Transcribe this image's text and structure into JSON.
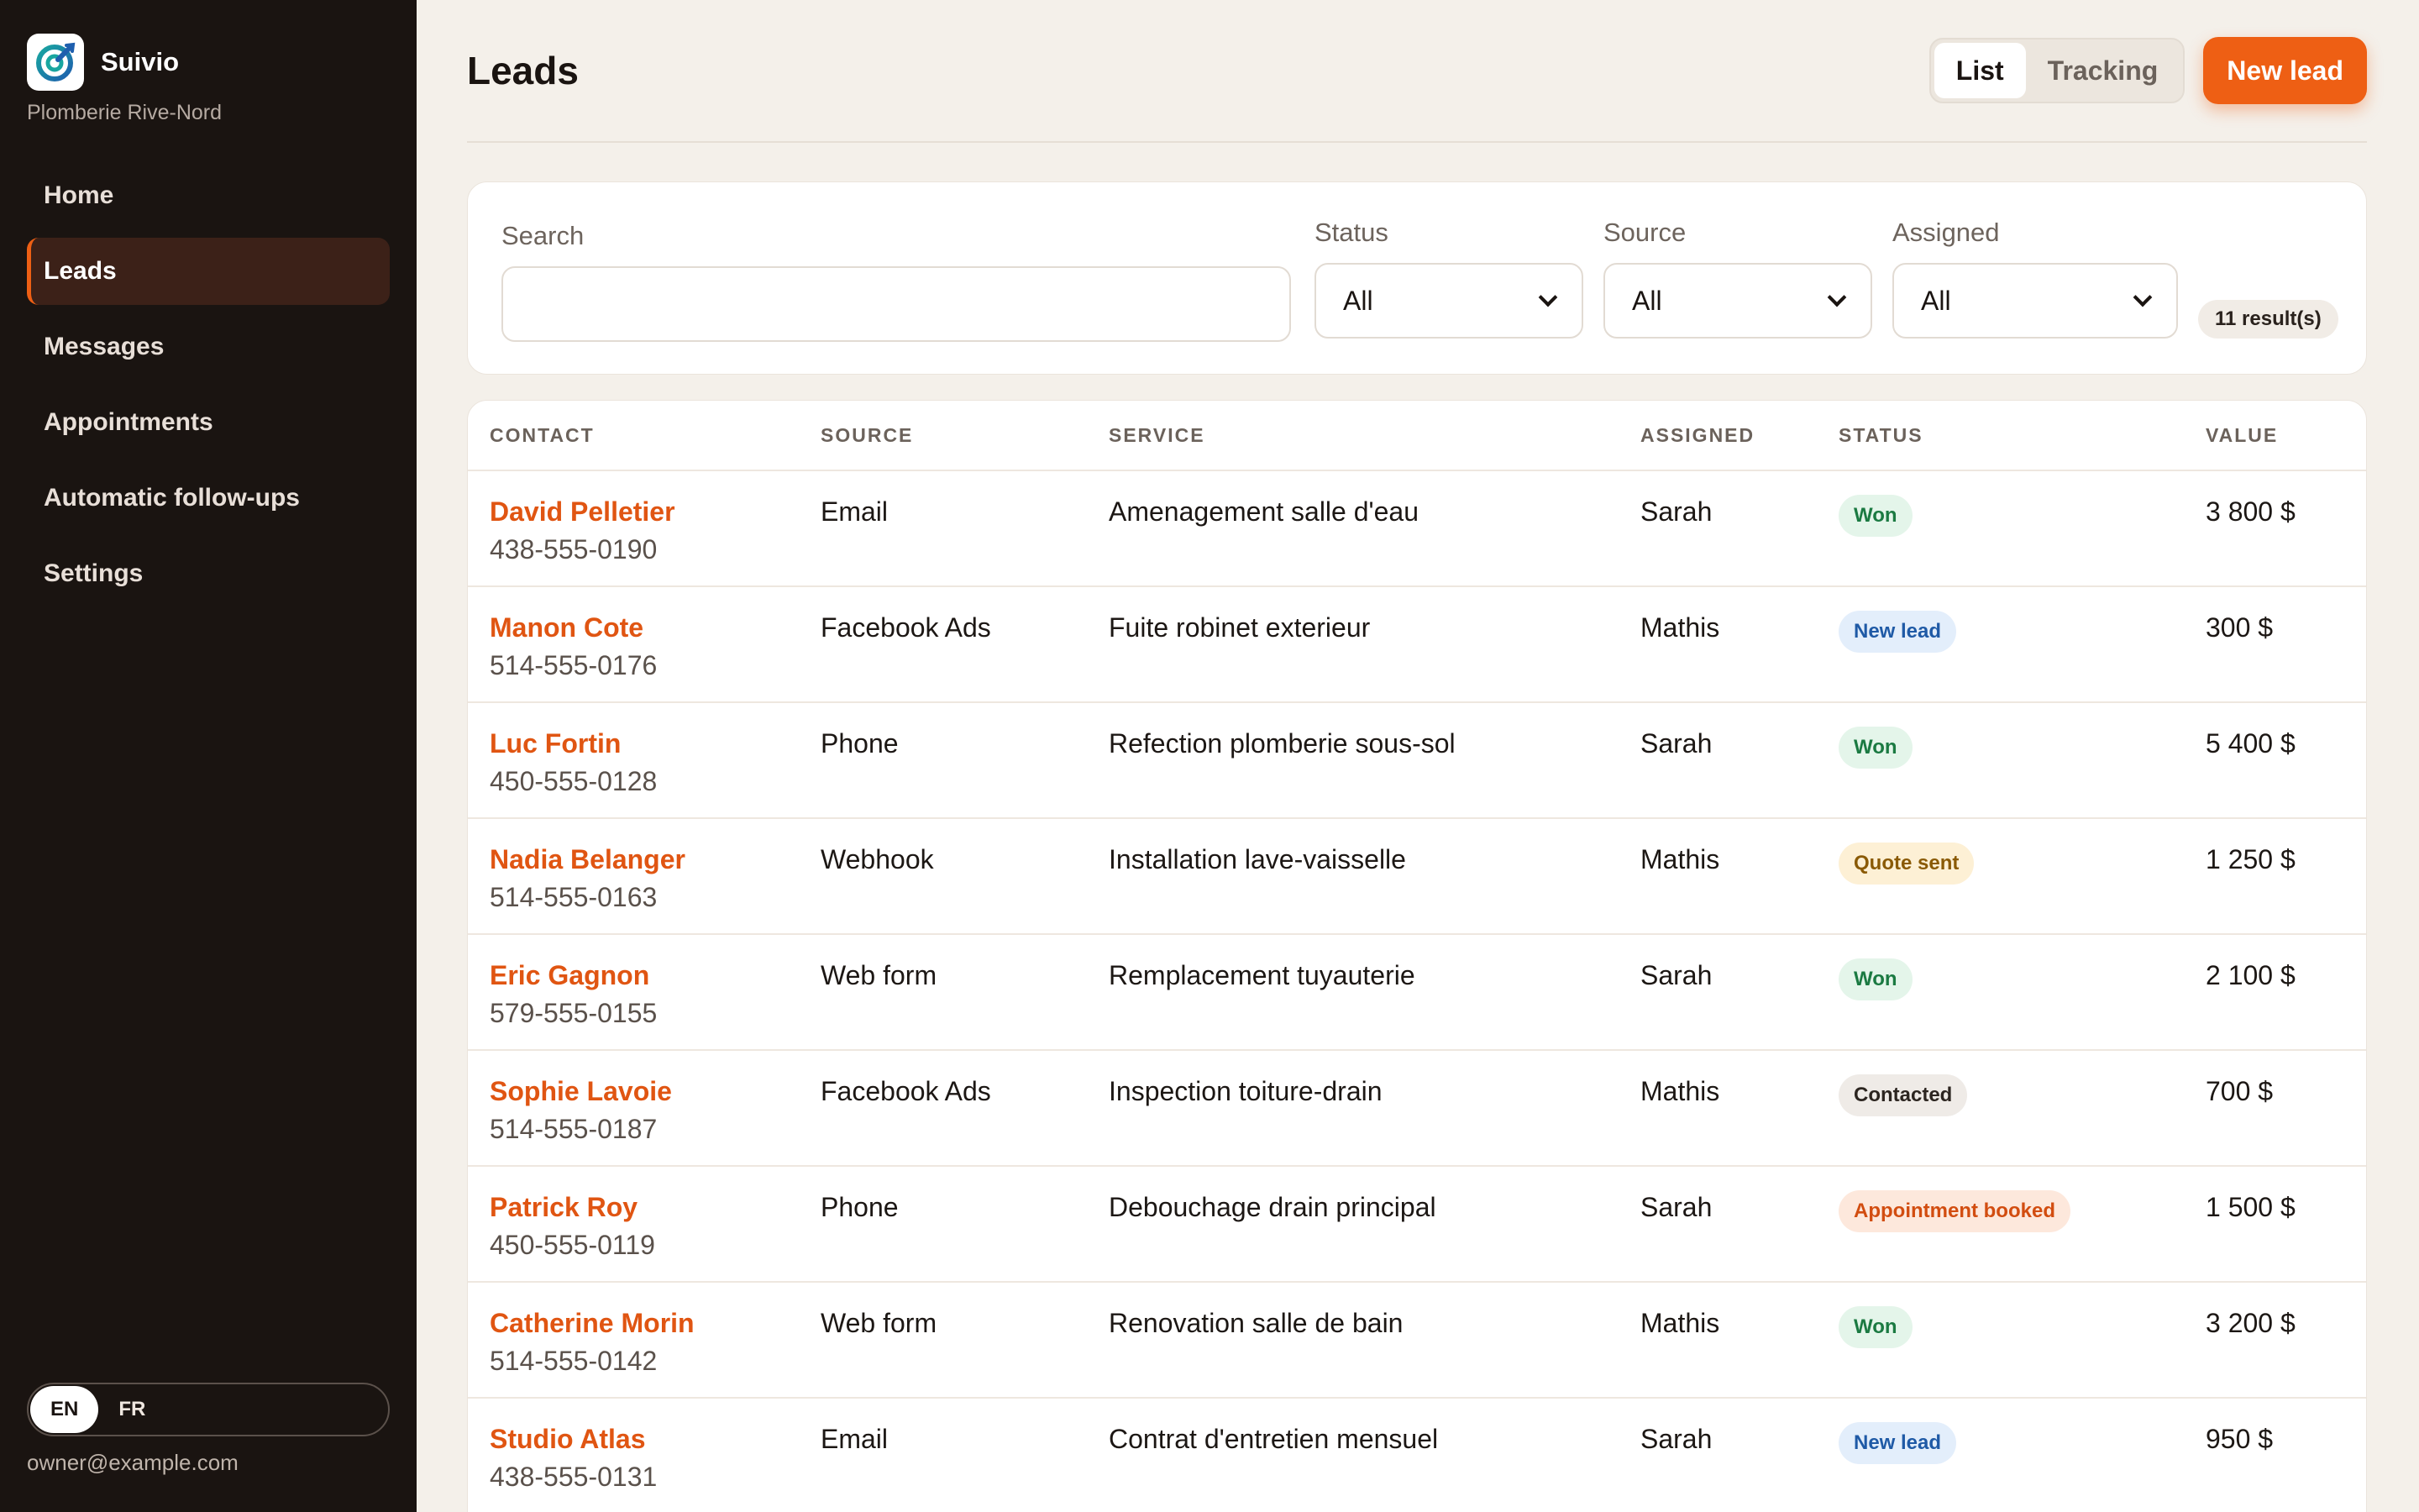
{
  "sidebar": {
    "brand_name": "Suivio",
    "brand_sub": "Plomberie Rive-Nord",
    "nav": [
      {
        "label": "Home",
        "active": false
      },
      {
        "label": "Leads",
        "active": true
      },
      {
        "label": "Messages",
        "active": false
      },
      {
        "label": "Appointments",
        "active": false
      },
      {
        "label": "Automatic follow-ups",
        "active": false
      },
      {
        "label": "Settings",
        "active": false
      }
    ],
    "lang": {
      "en": "EN",
      "fr": "FR",
      "active": "EN"
    },
    "user_email": "owner@example.com"
  },
  "header": {
    "title": "Leads",
    "view_list": "List",
    "view_tracking": "Tracking",
    "new_button": "New lead"
  },
  "filters": {
    "search_label": "Search",
    "search_value": "",
    "status_label": "Status",
    "status_value": "All",
    "source_label": "Source",
    "source_value": "All",
    "assigned_label": "Assigned",
    "assigned_value": "All",
    "result_count": "11 result(s)"
  },
  "table": {
    "columns": [
      "CONTACT",
      "SOURCE",
      "SERVICE",
      "ASSIGNED",
      "STATUS",
      "VALUE"
    ],
    "rows": [
      {
        "name": "David Pelletier",
        "phone": "438-555-0190",
        "source": "Email",
        "service": "Amenagement salle d'eau",
        "assigned": "Sarah",
        "status": "Won",
        "value": "3 800 $"
      },
      {
        "name": "Manon Cote",
        "phone": "514-555-0176",
        "source": "Facebook Ads",
        "service": "Fuite robinet exterieur",
        "assigned": "Mathis",
        "status": "New lead",
        "value": "300 $"
      },
      {
        "name": "Luc Fortin",
        "phone": "450-555-0128",
        "source": "Phone",
        "service": "Refection plomberie sous-sol",
        "assigned": "Sarah",
        "status": "Won",
        "value": "5 400 $"
      },
      {
        "name": "Nadia Belanger",
        "phone": "514-555-0163",
        "source": "Webhook",
        "service": "Installation lave-vaisselle",
        "assigned": "Mathis",
        "status": "Quote sent",
        "value": "1 250 $"
      },
      {
        "name": "Eric Gagnon",
        "phone": "579-555-0155",
        "source": "Web form",
        "service": "Remplacement tuyauterie",
        "assigned": "Sarah",
        "status": "Won",
        "value": "2 100 $"
      },
      {
        "name": "Sophie Lavoie",
        "phone": "514-555-0187",
        "source": "Facebook Ads",
        "service": "Inspection toiture-drain",
        "assigned": "Mathis",
        "status": "Contacted",
        "value": "700 $"
      },
      {
        "name": "Patrick Roy",
        "phone": "450-555-0119",
        "source": "Phone",
        "service": "Debouchage drain principal",
        "assigned": "Sarah",
        "status": "Appointment booked",
        "value": "1 500 $"
      },
      {
        "name": "Catherine Morin",
        "phone": "514-555-0142",
        "source": "Web form",
        "service": "Renovation salle de bain",
        "assigned": "Mathis",
        "status": "Won",
        "value": "3 200 $"
      },
      {
        "name": "Studio Atlas",
        "phone": "438-555-0131",
        "source": "Email",
        "service": "Contrat d'entretien mensuel",
        "assigned": "Sarah",
        "status": "New lead",
        "value": "950 $"
      }
    ]
  },
  "colors": {
    "accent": "#ee5f14",
    "sidebar_bg": "#1a1411",
    "page_bg": "#f4f0ea",
    "status": {
      "Won": {
        "bg": "#e4f5ea",
        "fg": "#1b7a42"
      },
      "New lead": {
        "bg": "#e3eefb",
        "fg": "#1f5aa6"
      },
      "Quote sent": {
        "bg": "#fdf0d5",
        "fg": "#8a5a05"
      },
      "Contacted": {
        "bg": "#efebe7",
        "fg": "#2c2520"
      },
      "Appointment booked": {
        "bg": "#fde8dc",
        "fg": "#d24d10"
      }
    }
  },
  "icons": {
    "brand": "suivio-logo-icon",
    "select": "chevron-down-icon"
  }
}
